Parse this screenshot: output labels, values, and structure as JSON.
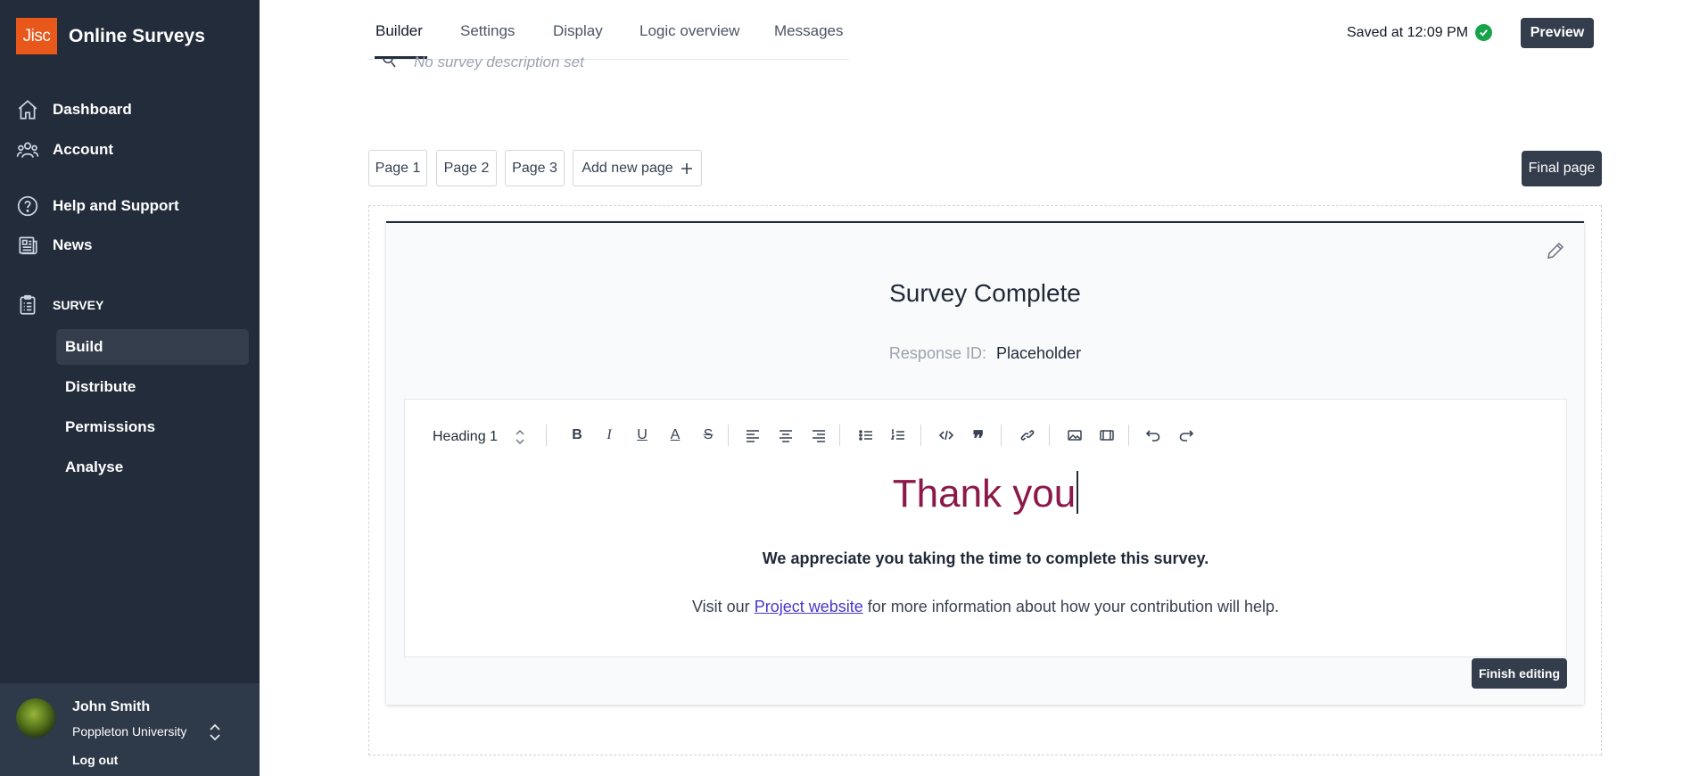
{
  "brand": {
    "logo_text": "Jisc",
    "app_name": "Online Surveys",
    "logo_color": "#e8581a"
  },
  "sidebar": {
    "nav": [
      {
        "label": "Dashboard",
        "icon": "home-icon"
      },
      {
        "label": "Account",
        "icon": "users-icon"
      },
      {
        "label": "Help and Support",
        "icon": "help-icon"
      },
      {
        "label": "News",
        "icon": "news-icon"
      }
    ],
    "section_label": "SURVEY",
    "section_icon": "clipboard-icon",
    "sub_items": [
      "Build",
      "Distribute",
      "Permissions",
      "Analyse"
    ],
    "active_sub_item": "Build"
  },
  "user": {
    "name": "John Smith",
    "org": "Poppleton University",
    "logout_label": "Log out"
  },
  "tabs": [
    "Builder",
    "Settings",
    "Display",
    "Logic overview",
    "Messages"
  ],
  "active_tab": "Builder",
  "description_placeholder": "No survey description set",
  "save_status": "Saved at 12:09 PM",
  "preview_label": "Preview",
  "pages": [
    "Page 1",
    "Page 2",
    "Page 3"
  ],
  "add_page_label": "Add new page",
  "final_page_label": "Final page",
  "final_page": {
    "title": "Survey Complete",
    "response_id_label": "Response ID:",
    "response_id_value": "Placeholder",
    "heading_style": "Heading 1",
    "thank_you": "Thank you",
    "appreciate": "We appreciate you taking the time to complete this survey.",
    "visit_prefix": "Visit our",
    "visit_link": "Project website",
    "visit_suffix": "for more information about how your contribution will help.",
    "finish_label": "Finish editing"
  },
  "colors": {
    "sidebar_bg": "#222c3a",
    "accent_dark": "#333d4b",
    "heading_color": "#8b1a4a",
    "link_color": "#4338ca",
    "success": "#16a34a"
  }
}
